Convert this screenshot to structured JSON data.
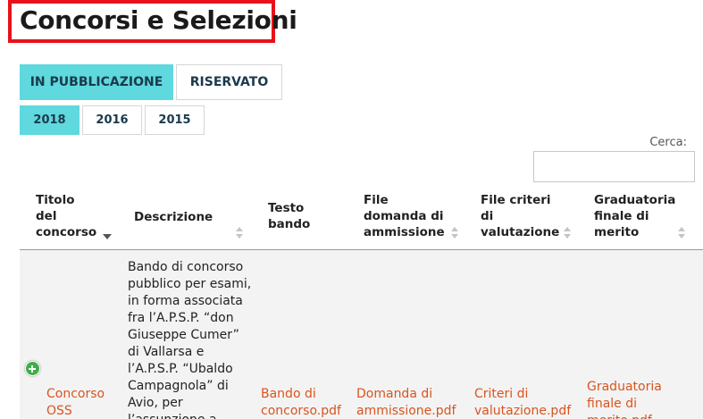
{
  "page": {
    "title": "Concorsi e Selezioni"
  },
  "tabs": [
    {
      "label": "IN PUBBLICAZIONE",
      "active": true
    },
    {
      "label": "RISERVATO",
      "active": false
    }
  ],
  "years": [
    {
      "label": "2018",
      "active": true
    },
    {
      "label": "2016",
      "active": false
    },
    {
      "label": "2015",
      "active": false
    }
  ],
  "search": {
    "label": "Cerca:",
    "value": ""
  },
  "table": {
    "headers": [
      "Titolo\ndel\nconcorso",
      "Descrizione",
      "Testo\nbando",
      "File\ndomanda di\nammissione",
      "File criteri\ndi\nvalutazione",
      "Graduatoria\nfinale di\nmerito"
    ],
    "rows": [
      {
        "titolo": "Concorso\nOSS",
        "descrizione": "Bando di concorso\npubblico per esami,\nin forma associata\nfra l’A.P.S.P. “don\nGiuseppe Cumer”\ndi Vallarsa e\nl’A.P.S.P. “Ubaldo\nCampagnola” di\nAvio, per\nl’assunzione a",
        "testo_bando": "Bando di\nconcorso.pdf",
        "domanda": "Domanda di\nammissione.pdf",
        "criteri": "Criteri di\nvalutazione.pdf",
        "graduatoria": "Graduatoria\nfinale di\nmerito.pdf"
      }
    ]
  },
  "colors": {
    "accent": "#5fd8de",
    "highlight": "#e8121c",
    "link": "#d9541e",
    "expand": "#3fae49"
  }
}
